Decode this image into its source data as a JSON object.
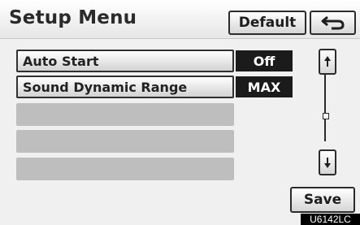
{
  "header": {
    "title": "Setup Menu",
    "default_label": "Default"
  },
  "rows": [
    {
      "label": "Auto Start",
      "value": "Off"
    },
    {
      "label": "Sound Dynamic Range",
      "value": "MAX"
    }
  ],
  "footer": {
    "save_label": "Save"
  },
  "figure_code": "U6142LC",
  "icons": {
    "back": "return-arrow-icon",
    "scroll_up": "scroll-up-icon",
    "scroll_down": "scroll-down-icon"
  }
}
